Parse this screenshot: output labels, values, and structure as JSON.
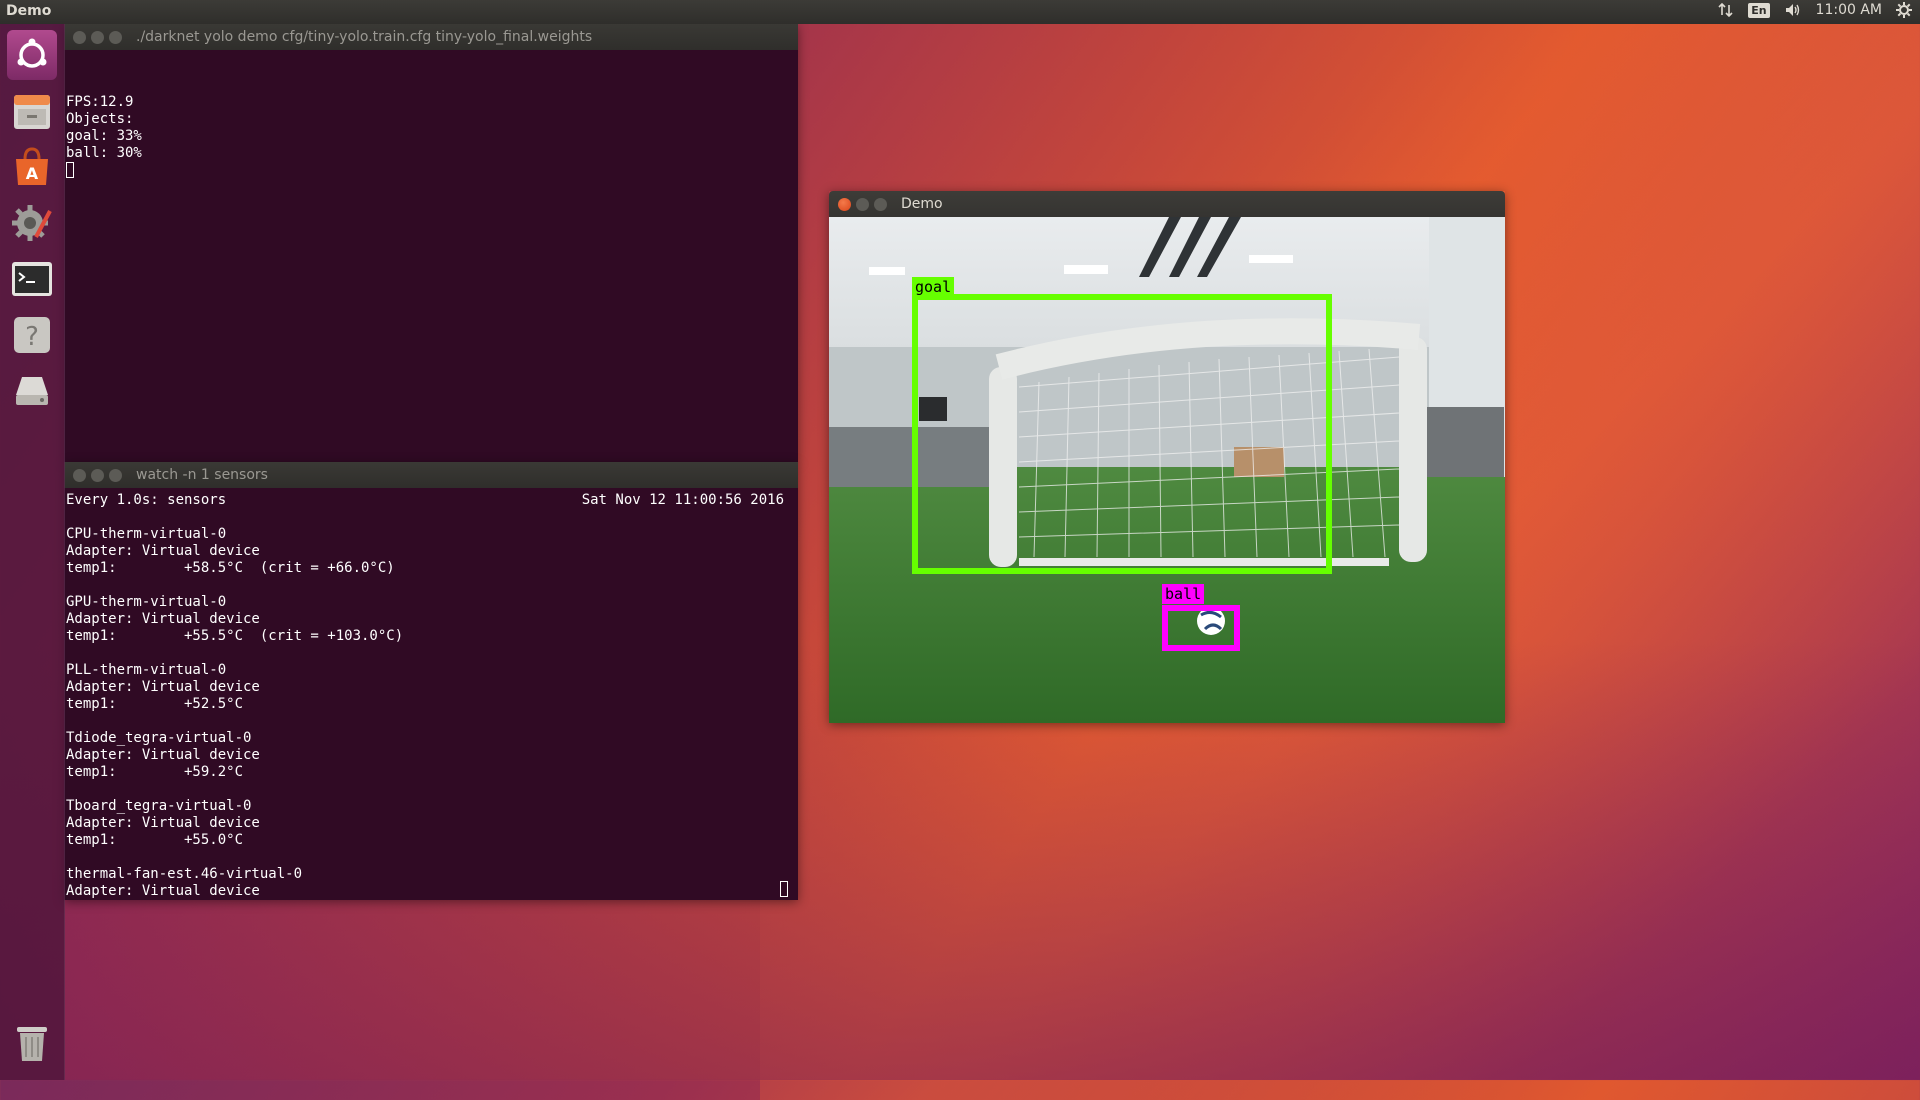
{
  "panel": {
    "app_title": "Demo",
    "indicators": {
      "network_icon": "network-arrows-icon",
      "keyboard_layout": "En",
      "volume_icon": "volume-icon",
      "clock": "11:00 AM",
      "system_icon": "gear-icon"
    }
  },
  "launcher": {
    "items": [
      {
        "name": "ubuntu-dash",
        "icon": "ubuntu-logo-icon"
      },
      {
        "name": "files",
        "icon": "file-cabinet-icon"
      },
      {
        "name": "software-center",
        "icon": "shopping-bag-icon"
      },
      {
        "name": "system-settings",
        "icon": "settings-gear-icon"
      },
      {
        "name": "terminal",
        "icon": "terminal-icon"
      },
      {
        "name": "help",
        "icon": "help-icon"
      },
      {
        "name": "disk",
        "icon": "drive-icon"
      },
      {
        "name": "trash",
        "icon": "trash-icon"
      }
    ]
  },
  "term1": {
    "title": "./darknet yolo demo cfg/tiny-yolo.train.cfg tiny-yolo_final.weights",
    "lines": [
      "FPS:12.9",
      "Objects:",
      "",
      "goal: 33%",
      "ball: 30%"
    ]
  },
  "term2": {
    "title": "watch -n 1 sensors",
    "header_left": "Every 1.0s: sensors",
    "header_right": "Sat Nov 12 11:00:56 2016",
    "lines": [
      "",
      "CPU-therm-virtual-0",
      "Adapter: Virtual device",
      "temp1:        +58.5°C  (crit = +66.0°C)",
      "",
      "GPU-therm-virtual-0",
      "Adapter: Virtual device",
      "temp1:        +55.5°C  (crit = +103.0°C)",
      "",
      "PLL-therm-virtual-0",
      "Adapter: Virtual device",
      "temp1:        +52.5°C",
      "",
      "Tdiode_tegra-virtual-0",
      "Adapter: Virtual device",
      "temp1:        +59.2°C",
      "",
      "Tboard_tegra-virtual-0",
      "Adapter: Virtual device",
      "temp1:        +55.0°C",
      "",
      "thermal-fan-est.46-virtual-0",
      "Adapter: Virtual device"
    ]
  },
  "demo": {
    "title": "Demo",
    "detections": [
      {
        "label": "goal",
        "color": "#66ff00"
      },
      {
        "label": "ball",
        "color": "#ff00ff"
      }
    ]
  }
}
